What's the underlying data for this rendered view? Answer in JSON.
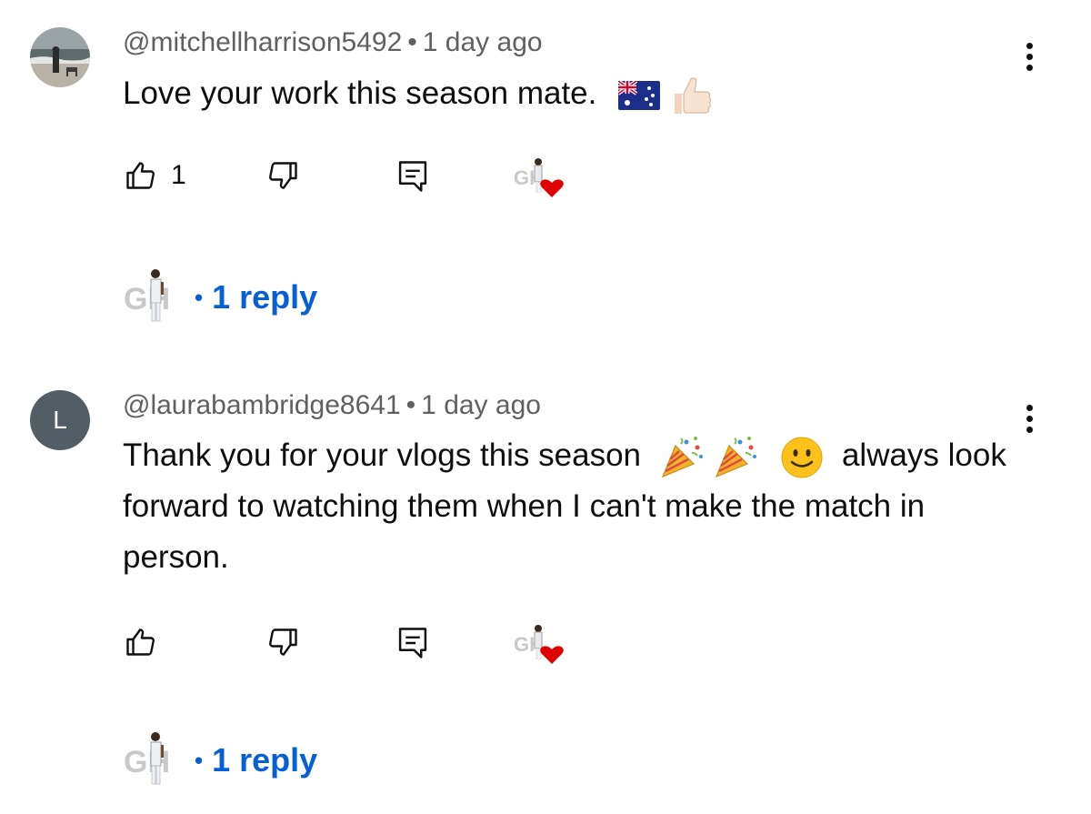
{
  "comments": [
    {
      "handle": "@mitchellharrison5492",
      "time": "1 day ago",
      "text": "Love your work this season mate.",
      "emojis": [
        "australia-flag",
        "thumbs-up"
      ],
      "like_count": "1",
      "replies_label": "1 reply",
      "avatar": "photo"
    },
    {
      "handle": "@laurabambridge8641",
      "time": "1 day ago",
      "avatar_letter": "L",
      "text_part1": "Thank you for your vlogs this season",
      "text_part2": "always look forward to watching them when I can't make the match in person.",
      "emojis": [
        "party-popper",
        "party-popper",
        "smiling-face"
      ],
      "like_count": "",
      "replies_label": "1 reply"
    }
  ],
  "separator": "•",
  "colors": {
    "link": "#065fd4",
    "meta": "#606060",
    "heart": "#e00000",
    "avatar_bg": "#525d66"
  }
}
